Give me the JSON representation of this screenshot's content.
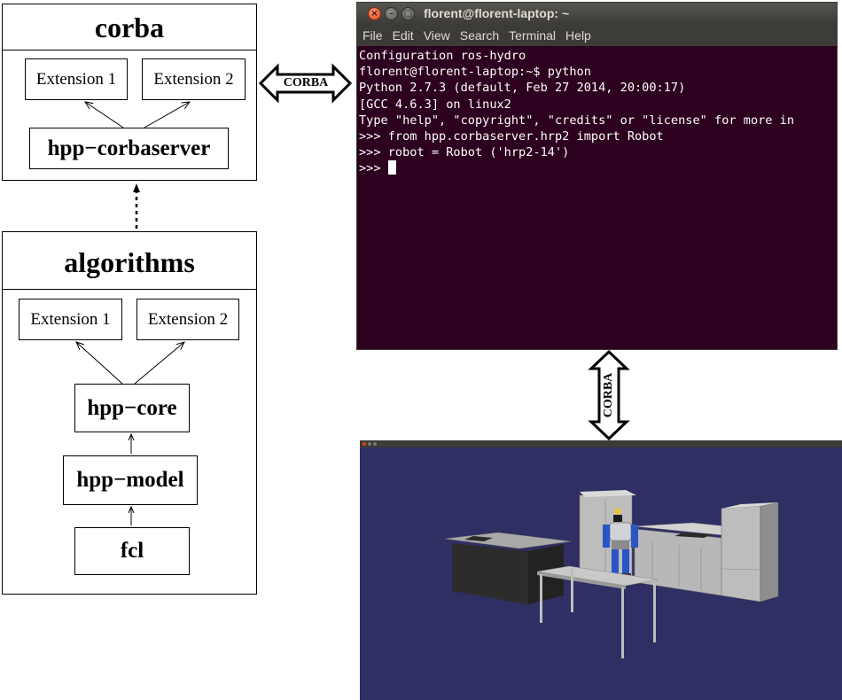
{
  "corba": {
    "title": "corba",
    "extensions": [
      "Extension 1",
      "Extension 2"
    ],
    "server": "hpp−corbaserver"
  },
  "algorithms": {
    "title": "algorithms",
    "extensions": [
      "Extension 1",
      "Extension 2"
    ],
    "modules": [
      "hpp−core",
      "hpp−model",
      "fcl"
    ]
  },
  "links": {
    "horizontal": "CORBA",
    "vertical": "CORBA"
  },
  "terminal": {
    "title": "florent@florent-laptop: ~",
    "menu": [
      "File",
      "Edit",
      "View",
      "Search",
      "Terminal",
      "Help"
    ],
    "lines": [
      "Configuration ros-hydro",
      "florent@florent-laptop:~$ python",
      "Python 2.7.3 (default, Feb 27 2014, 20:00:17)",
      "[GCC 4.6.3] on linux2",
      "Type \"help\", \"copyright\", \"credits\" or \"license\" for more in",
      ">>> from hpp.corbaserver.hrp2 import Robot",
      ">>> robot = Robot ('hrp2-14')",
      ">>> "
    ],
    "colors": {
      "background": "#2c001e",
      "text": "#ffffff"
    }
  },
  "viewer": {
    "colors": {
      "background": "#2f2f63"
    }
  }
}
